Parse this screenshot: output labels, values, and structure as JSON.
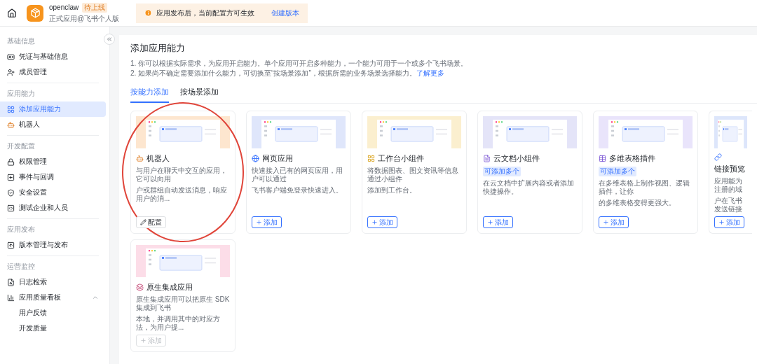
{
  "topbar": {
    "app_name": "openclaw",
    "status_badge": "待上线",
    "app_subtitle": "正式应用@飞书个人版",
    "notice": "应用发布后，当前配置方可生效",
    "notice_link": "创建版本"
  },
  "sidebar": {
    "sections": [
      {
        "title": "基础信息",
        "items": [
          {
            "kind": "credential",
            "label": "凭证与基础信息",
            "selected": false
          },
          {
            "kind": "member",
            "label": "成员管理",
            "selected": false
          }
        ]
      },
      {
        "title": "应用能力",
        "items": [
          {
            "kind": "grid",
            "label": "添加应用能力",
            "selected": true
          },
          {
            "kind": "bot",
            "label": "机器人",
            "selected": false
          }
        ]
      },
      {
        "title": "开发配置",
        "items": [
          {
            "kind": "lock",
            "label": "权限管理",
            "selected": false
          },
          {
            "kind": "event",
            "label": "事件与回调",
            "selected": false
          },
          {
            "kind": "shield",
            "label": "安全设置",
            "selected": false
          },
          {
            "kind": "code",
            "label": "测试企业和人员",
            "selected": false
          }
        ]
      },
      {
        "title": "应用发布",
        "items": [
          {
            "kind": "upload",
            "label": "版本管理与发布",
            "selected": false
          }
        ]
      },
      {
        "title": "运营监控",
        "items": [
          {
            "kind": "log",
            "label": "日志检索",
            "selected": false
          },
          {
            "kind": "chart",
            "label": "应用质量看板",
            "selected": false,
            "expanded": true,
            "children": [
              {
                "label": "用户反馈",
                "selected": false
              },
              {
                "label": "开发质量",
                "selected": false
              }
            ]
          }
        ]
      }
    ]
  },
  "main": {
    "title": "添加应用能力",
    "notes": [
      "1. 你可以根据实际需求，为应用开启能力。单个应用可开启多种能力，一个能力可用于一个或多个飞书场景。",
      "2. 如果尚不确定需要添加什么能力，可切换至“按场景添加”，根据所需的业务场景选择能力。"
    ],
    "notes_link": "了解更多",
    "tabs": [
      {
        "label": "按能力添加",
        "selected": true
      },
      {
        "label": "按场景添加",
        "selected": false
      }
    ],
    "cards": [
      {
        "kind": "bot",
        "color": "#fde6cf",
        "title": "机器人",
        "lines": [
          "与用户在聊天中交互的应用，它可以向用",
          "户或群组自动发送消息，响应用户的消..."
        ],
        "action": {
          "kind": "configure",
          "label": "配置",
          "disabled": false
        },
        "circled": true
      },
      {
        "kind": "web",
        "color": "#dfe6fb",
        "title": "网页应用",
        "lines": [
          "快速接入已有的网页应用，用户可以通过",
          "飞书客户端免登录快速进入。"
        ],
        "action": {
          "kind": "add",
          "label": "添加",
          "disabled": false
        },
        "circled": false
      },
      {
        "kind": "widget",
        "color": "#fbefcf",
        "title": "工作台小组件",
        "lines": [
          "将数据图表、图文资讯等信息通过小组件",
          "添加到工作台。"
        ],
        "action": {
          "kind": "add",
          "label": "添加",
          "disabled": false
        },
        "circled": false
      },
      {
        "kind": "doc",
        "color": "#e4e4f8",
        "title": "云文档小组件",
        "tag": "可添加多个",
        "lines": [
          "在云文档中扩展内容或者添加快捷操作。"
        ],
        "action": {
          "kind": "add",
          "label": "添加",
          "disabled": false
        },
        "circled": false
      },
      {
        "kind": "table",
        "color": "#e9e4fb",
        "title": "多维表格插件",
        "tag": "可添加多个",
        "lines": [
          "在多维表格上制作视图、逻辑插件，让你",
          "的多维表格变得更强大。"
        ],
        "action": {
          "kind": "add",
          "label": "添加",
          "disabled": false
        },
        "circled": false
      },
      {
        "kind": "link",
        "color": "#dde6fb",
        "title": "链接预览",
        "lines": [
          "应用能为注册的域",
          "户在飞书发送链接"
        ],
        "action": {
          "kind": "add",
          "label": "添加",
          "disabled": false
        },
        "circled": false
      },
      {
        "kind": "native",
        "color": "#fcdde8",
        "title": "原生集成应用",
        "lines": [
          "原生集成应用可以把原生 SDK 集成到飞书",
          "本地，并调用其中的对应方法，为用户提..."
        ],
        "action": {
          "kind": "add",
          "label": "添加",
          "disabled": true
        },
        "circled": false
      }
    ]
  }
}
